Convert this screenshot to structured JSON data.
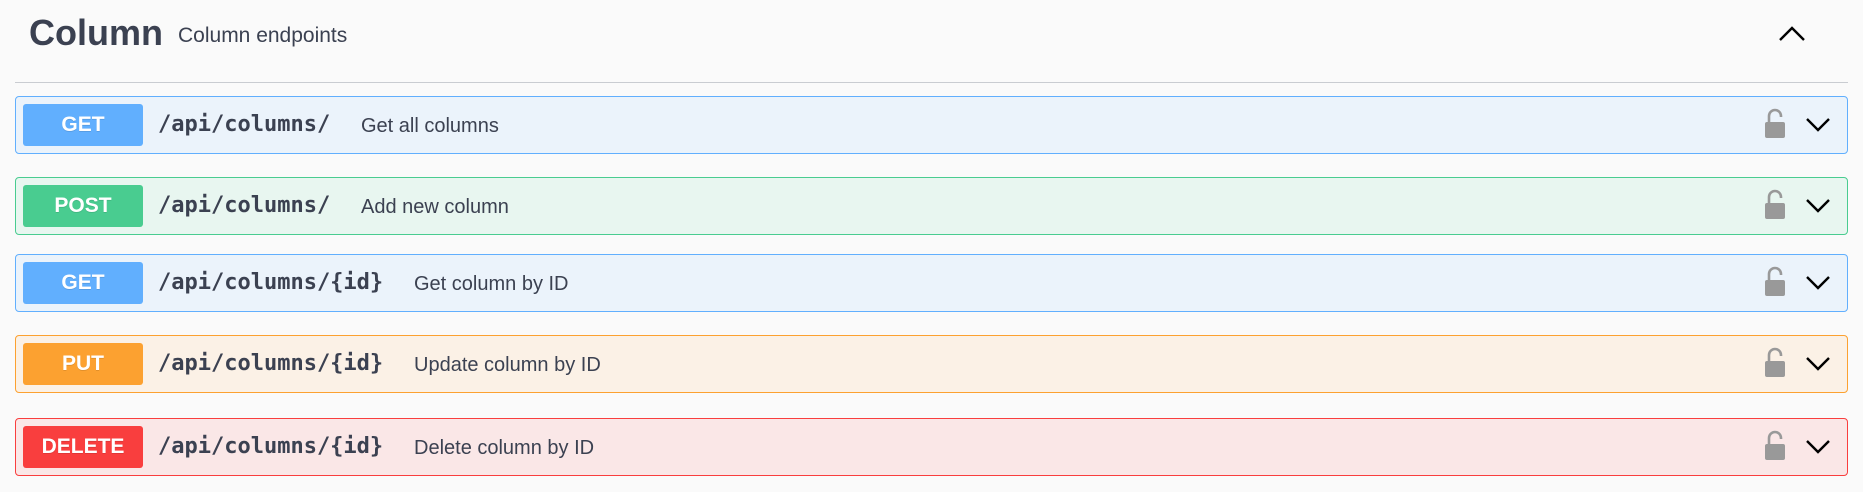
{
  "tag": {
    "title": "Column",
    "description": "Column endpoints"
  },
  "operations": [
    {
      "method": "GET",
      "path": "/api/columns/",
      "summary": "Get all columns"
    },
    {
      "method": "POST",
      "path": "/api/columns/",
      "summary": "Add new column"
    },
    {
      "method": "GET",
      "path": "/api/columns/{id}",
      "summary": "Get column by ID"
    },
    {
      "method": "PUT",
      "path": "/api/columns/{id}",
      "summary": "Update column by ID"
    },
    {
      "method": "DELETE",
      "path": "/api/columns/{id}",
      "summary": "Delete column by ID"
    }
  ],
  "icons": {
    "collapse": "chevron-up-icon",
    "lock": "unlocked-padlock-icon",
    "expand": "chevron-down-icon"
  },
  "colors": {
    "get": "#61affe",
    "post": "#49cc90",
    "put": "#fca130",
    "delete": "#f93e3e",
    "text": "#3b4151"
  }
}
